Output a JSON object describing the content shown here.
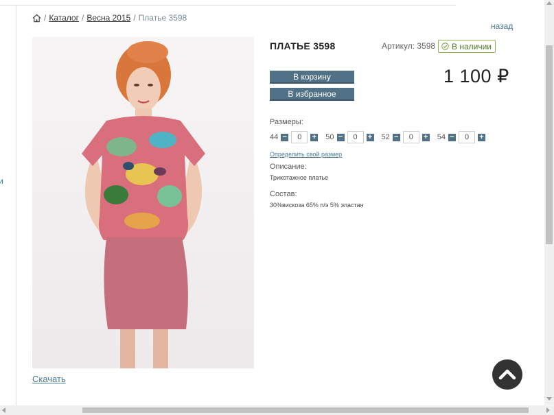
{
  "left_fragment": "и",
  "breadcrumb": {
    "items": [
      "Каталог",
      "Весна 2015"
    ],
    "separator": "/",
    "current": "Платье 3598"
  },
  "back_link": "назад",
  "product": {
    "title": "ПЛАТЬЕ 3598",
    "sku": "Артикул: 3598",
    "stock": "В наличии",
    "price": "1 100 ₽",
    "add_to_cart": "В корзину",
    "add_to_favorites": "В избранное",
    "sizes_label": "Размеры:",
    "sizes": [
      {
        "size": "44",
        "qty": "0"
      },
      {
        "size": "50",
        "qty": "0"
      },
      {
        "size": "52",
        "qty": "0"
      },
      {
        "size": "54",
        "qty": "0"
      }
    ],
    "size_link": "Определить свой размер",
    "description_label": "Описание:",
    "description": "Трикотажное платье",
    "composition_label": "Состав:",
    "composition": "30%вискоза 65% п/э 5% эластан"
  },
  "download_link": "Скачать",
  "colors": {
    "button": "#517286",
    "stock_border": "#8db255",
    "link": "#4a7891"
  },
  "icons": {
    "home": "home-icon",
    "stock": "check-circle-icon",
    "scroll_top": "chevron-up-icon"
  }
}
